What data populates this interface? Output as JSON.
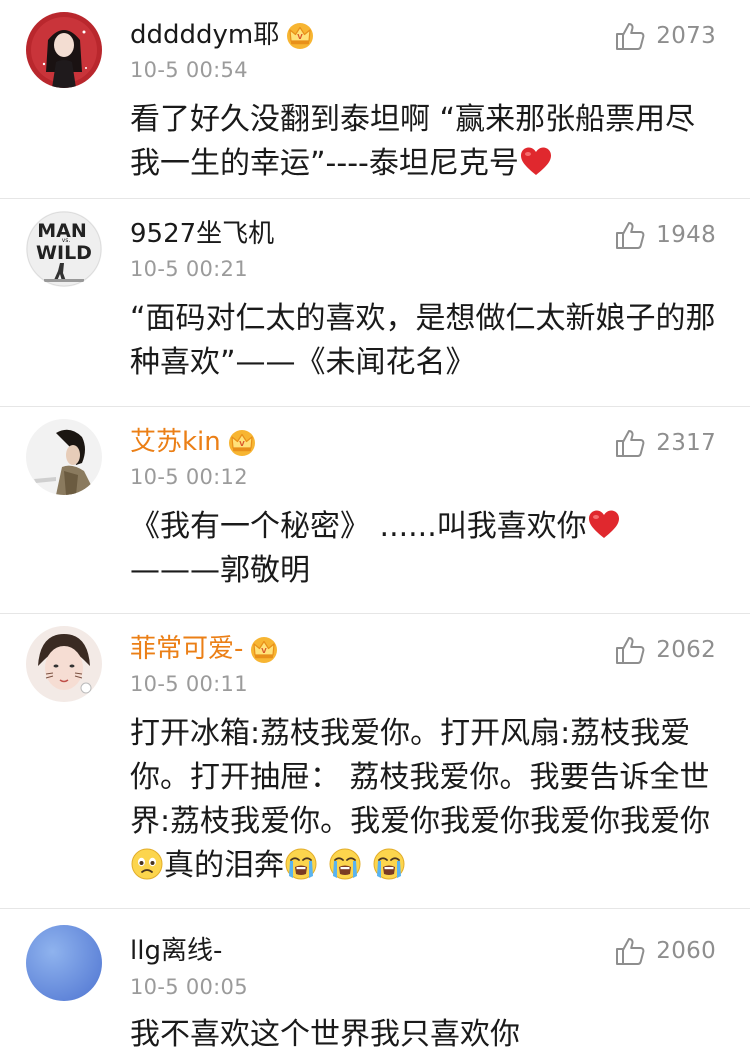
{
  "comments": [
    {
      "username": "dddddym耶",
      "time": "10-5 00:54",
      "likes": "2073",
      "lines": [
        "看了好久没翻到泰坦啊 “赢来那张船票用尽",
        "我一生的幸运”----泰坦尼克号"
      ]
    },
    {
      "username": "9527坐飞机",
      "time": "10-5 00:21",
      "likes": "1948",
      "lines": [
        "“面码对仁太的喜欢，是想做仁太新娘子的那",
        "种喜欢”——《未闻花名》"
      ]
    },
    {
      "username": "艾苏kin",
      "time": "10-5 00:12",
      "likes": "2317",
      "lines": [
        "《我有一个秘密》 ......叫我喜欢你",
        "———郭敬明"
      ]
    },
    {
      "username": "菲常可爱-",
      "time": "10-5 00:11",
      "likes": "2062",
      "lines": [
        "打开冰箱:荔枝我爱你。打开风扇:荔枝我爱",
        "你。打开抽屉： 荔枝我爱你。我要告诉全世",
        "界:荔枝我爱你。我爱你我爱你我爱你我爱你",
        "真的泪奔"
      ]
    },
    {
      "username": "llg离线-",
      "time": "10-5 00:05",
      "likes": "2060",
      "lines": [
        "我不喜欢这个世界我只喜欢你"
      ]
    }
  ],
  "icons": {
    "like": "thumbs-up-icon",
    "vip": "crown-badge-icon",
    "heart": "red-heart-emoji",
    "worried": "worried-face-emoji",
    "crying": "loudly-crying-face-emoji"
  },
  "colors": {
    "vip_name": "#eb7f16",
    "text": "#1a1a1a",
    "meta": "#9b9b9b",
    "divider": "#e6e6e6",
    "heart": "#e0282e"
  }
}
